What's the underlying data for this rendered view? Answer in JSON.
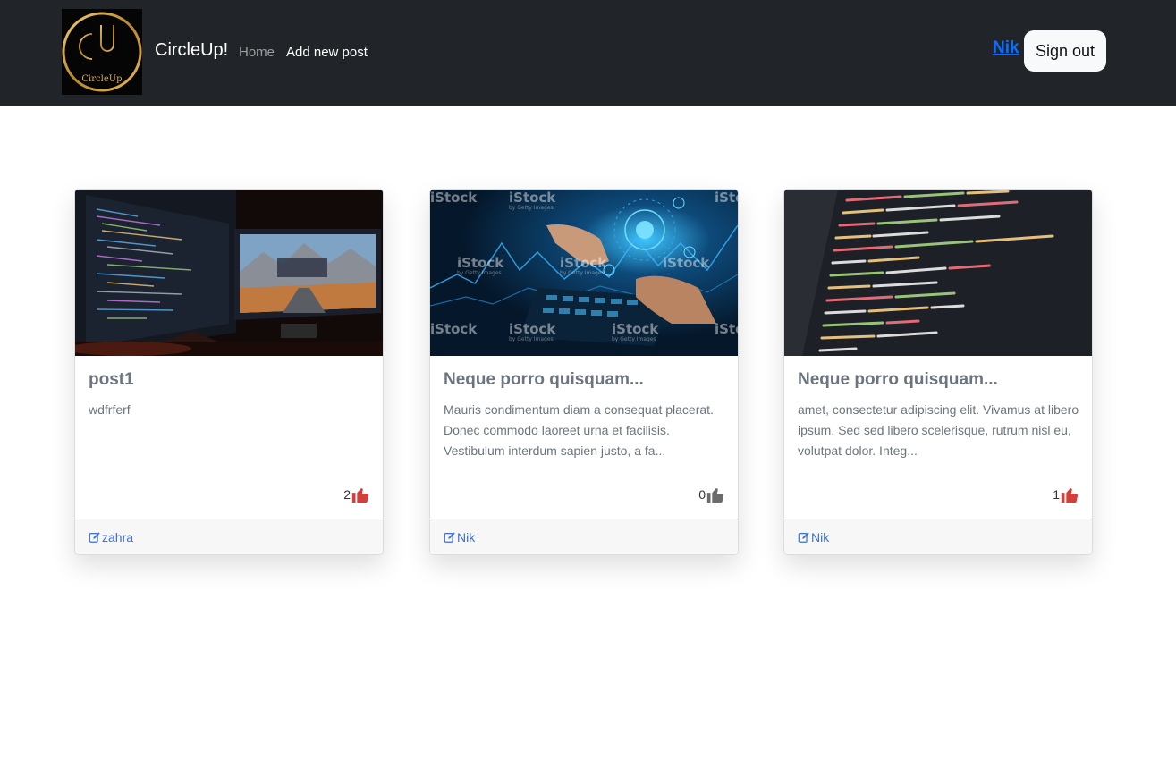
{
  "navbar": {
    "logo_text": "CircleUp",
    "brand": "CircleUp!",
    "links": [
      "Home",
      "Add new post"
    ],
    "user": "Nik",
    "signout_label": "Sign out"
  },
  "posts": [
    {
      "title": "post1",
      "body": "wdfrferf",
      "likes": "2",
      "liked": true,
      "author": "zahra",
      "image": "monitors-mountain-desktop"
    },
    {
      "title": "Neque porro quisquam...",
      "body": "Mauris condimentum diam a consequat placerat. Donec commodo laoreet urna et facilisis. Vestibulum interdum sapien justo, a fa...",
      "likes": "0",
      "liked": false,
      "author": "Nik",
      "image": "digital-tech-hands",
      "watermark": "iStock",
      "watermark_sub": "by Getty Images"
    },
    {
      "title": "Neque porro quisquam...",
      "body": "amet, consectetur adipiscing elit. Vivamus at libero ipsum. Sed sed libero scelerisque, rutrum nisl eu, volutpat dolor. Integ...",
      "likes": "1",
      "liked": true,
      "author": "Nik",
      "image": "code-screen"
    }
  ],
  "colors": {
    "navbar_bg": "#212529",
    "liked": "#d43f3a",
    "unliked": "#6c6c6c",
    "link": "#0d6efd",
    "author_link": "#3b6fd6"
  },
  "icons": [
    "thumbs-up-icon",
    "edit-icon"
  ]
}
